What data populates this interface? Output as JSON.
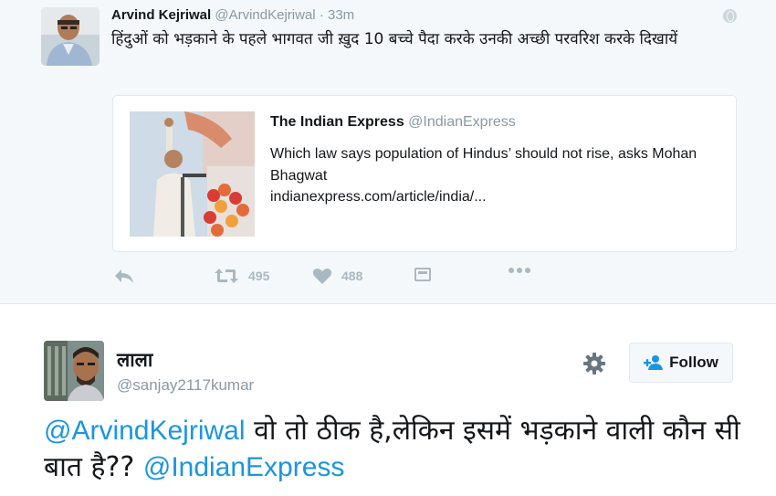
{
  "top_tweet": {
    "author_name": "Arvind Kejriwal",
    "handle": "@ArvindKejriwal",
    "separator": "·",
    "time": "33m",
    "text": "हिंदुओं को भड़काने के पहले भागवत जी ख़ुद 10 बच्चे पैदा करके उनकी अच्छी परवरिश करके दिखायें",
    "card": {
      "source_name": "The Indian Express",
      "source_handle": "@IndianExpress",
      "title": "Which law says population of Hindus’ should not rise, asks Mohan Bhagwat",
      "url": "indianexpress.com/article/india/..."
    },
    "actions": {
      "retweets": "495",
      "likes": "488"
    }
  },
  "reply_tweet": {
    "author_name": "लाला",
    "handle": "@sanjay2117kumar",
    "follow_label": "Follow",
    "mention_1": "@ArvindKejriwal",
    "text": " वो तो ठीक है,लेकिन इसमें भड़काने वाली कौन सी बात है?? ",
    "mention_2": "@IndianExpress"
  },
  "colors": {
    "background_top": "#f5f8fa",
    "link_blue": "#1b95e0",
    "muted": "#8899a6",
    "icon_grey": "#aab8c2"
  },
  "icons": [
    "globe-icon",
    "reply-icon",
    "retweet-icon",
    "heart-icon",
    "message-icon",
    "more-icon",
    "gear-icon",
    "follow-person-icon"
  ]
}
